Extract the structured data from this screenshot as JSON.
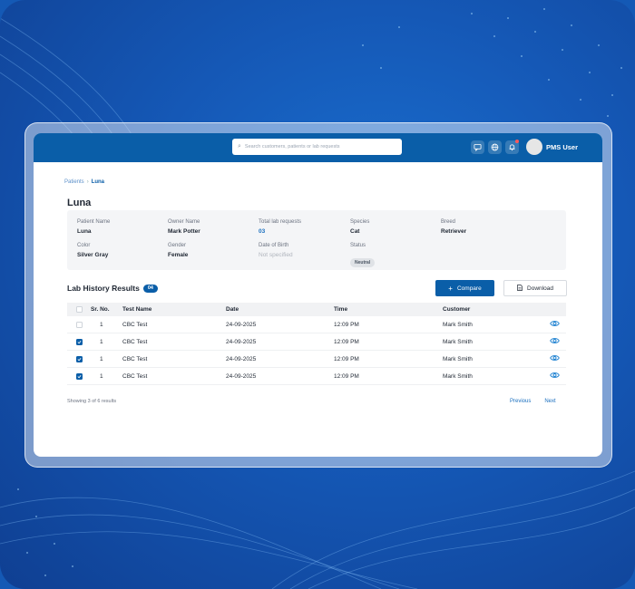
{
  "topbar": {
    "search_placeholder": "Search customers, patients or lab requests",
    "icons": [
      "chat-icon",
      "globe-icon",
      "bell-icon"
    ],
    "user_name": "PMS User"
  },
  "breadcrumb": {
    "root": "Patients",
    "current": "Luna"
  },
  "page_title": "Luna",
  "patient": {
    "patient_name": {
      "label": "Patient Name",
      "value": "Luna"
    },
    "owner_name": {
      "label": "Owner Name",
      "value": "Mark Potter"
    },
    "total_lab_requests": {
      "label": "Total lab requests",
      "value": "03"
    },
    "species": {
      "label": "Species",
      "value": "Cat"
    },
    "breed": {
      "label": "Breed",
      "value": "Retriever"
    },
    "color": {
      "label": "Color",
      "value": "Silver Gray"
    },
    "gender": {
      "label": "Gender",
      "value": "Female"
    },
    "dob": {
      "label": "Date of Birth",
      "value": "Not specified"
    },
    "status": {
      "label": "Status",
      "value": "Neutral"
    }
  },
  "lab_history": {
    "title": "Lab History Results",
    "count": "04",
    "compare_label": "Compare",
    "download_label": "Download",
    "columns": [
      "Sr. No.",
      "Test Name",
      "Date",
      "Time",
      "Customer"
    ],
    "rows": [
      {
        "checked": false,
        "sr": "1",
        "test": "CBC Test",
        "date": "24-09-2025",
        "time": "12:09 PM",
        "customer": "Mark Smith"
      },
      {
        "checked": true,
        "sr": "1",
        "test": "CBC Test",
        "date": "24-09-2025",
        "time": "12:09 PM",
        "customer": "Mark Smith"
      },
      {
        "checked": true,
        "sr": "1",
        "test": "CBC Test",
        "date": "24-09-2025",
        "time": "12:09 PM",
        "customer": "Mark Smith"
      },
      {
        "checked": true,
        "sr": "1",
        "test": "CBC Test",
        "date": "24-09-2025",
        "time": "12:09 PM",
        "customer": "Mark Smith"
      }
    ],
    "showing": "Showing 3 of 6 results",
    "previous": "Previous",
    "next": "Next"
  },
  "colors": {
    "brand": "#0a5ea8",
    "background": "#1459b5"
  }
}
